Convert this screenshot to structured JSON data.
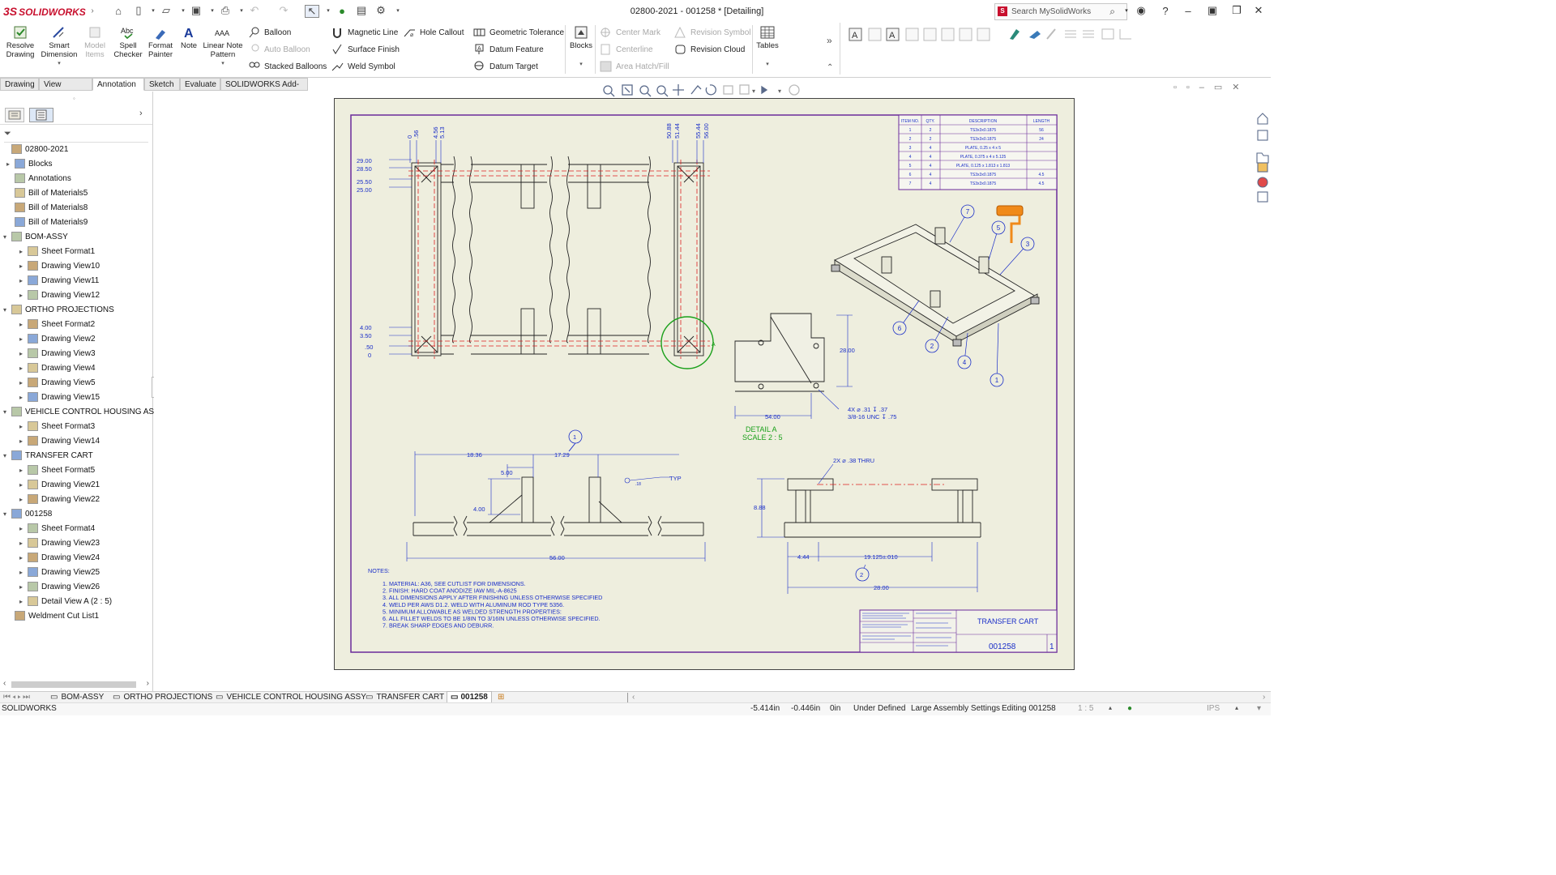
{
  "titlebar": {
    "logo_ds": "3S",
    "logo_text": "SOLIDWORKS",
    "document_title": "02800-2021 - 001258 * [Detailing]",
    "search_placeholder": "Search MySolidWorks"
  },
  "ribbon": {
    "big_buttons": [
      {
        "label1": "Resolve",
        "label2": "Drawing",
        "enabled": true
      },
      {
        "label1": "Smart",
        "label2": "Dimension",
        "enabled": true
      },
      {
        "label1": "Model",
        "label2": "Items",
        "enabled": false
      },
      {
        "label1": "Spell",
        "label2": "Checker",
        "enabled": true
      },
      {
        "label1": "Format",
        "label2": "Painter",
        "enabled": true
      },
      {
        "label1": "Note",
        "label2": "",
        "enabled": true
      },
      {
        "label1": "Linear Note",
        "label2": "Pattern",
        "enabled": true
      }
    ],
    "col1": [
      {
        "label": "Balloon",
        "enabled": true
      },
      {
        "label": "Auto Balloon",
        "enabled": false
      },
      {
        "label": "Stacked Balloons",
        "enabled": true
      }
    ],
    "col2": [
      {
        "label": "Magnetic Line",
        "enabled": true
      },
      {
        "label": "Surface Finish",
        "enabled": true
      },
      {
        "label": "Weld Symbol",
        "enabled": true
      }
    ],
    "hole_callout": "Hole Callout",
    "col3": [
      {
        "label": "Geometric Tolerance",
        "enabled": true
      },
      {
        "label": "Datum Feature",
        "enabled": true
      },
      {
        "label": "Datum Target",
        "enabled": true
      }
    ],
    "blocks": "Blocks",
    "col4": [
      {
        "label": "Center Mark",
        "enabled": false
      },
      {
        "label": "Centerline",
        "enabled": false
      },
      {
        "label": "Area Hatch/Fill",
        "enabled": false
      }
    ],
    "col5": [
      {
        "label": "Revision Symbol",
        "enabled": false
      },
      {
        "label": "Revision Cloud",
        "enabled": true
      }
    ],
    "tables": "Tables"
  },
  "tabs": [
    "Drawing",
    "View Layout",
    "Annotation",
    "Sketch",
    "Evaluate",
    "SOLIDWORKS Add-Ins"
  ],
  "active_tab": "Annotation",
  "tree": [
    {
      "label": "02800-2021",
      "level": 0,
      "arrow": ""
    },
    {
      "label": "Blocks",
      "level": 1,
      "arrow": "▸"
    },
    {
      "label": "Annotations",
      "level": 1,
      "arrow": ""
    },
    {
      "label": "Bill of Materials5",
      "level": 1,
      "arrow": ""
    },
    {
      "label": "Bill of Materials8",
      "level": 1,
      "arrow": ""
    },
    {
      "label": "Bill of Materials9",
      "level": 1,
      "arrow": ""
    },
    {
      "label": "BOM-ASSY",
      "level": 0,
      "arrow": "▾"
    },
    {
      "label": "Sheet Format1",
      "level": 2,
      "arrow": "▸"
    },
    {
      "label": "Drawing View10",
      "level": 2,
      "arrow": "▸"
    },
    {
      "label": "Drawing View11",
      "level": 2,
      "arrow": "▸"
    },
    {
      "label": "Drawing View12",
      "level": 2,
      "arrow": "▸"
    },
    {
      "label": "ORTHO PROJECTIONS",
      "level": 0,
      "arrow": "▾"
    },
    {
      "label": "Sheet Format2",
      "level": 2,
      "arrow": "▸"
    },
    {
      "label": "Drawing View2",
      "level": 2,
      "arrow": "▸"
    },
    {
      "label": "Drawing View3",
      "level": 2,
      "arrow": "▸"
    },
    {
      "label": "Drawing View4",
      "level": 2,
      "arrow": "▸"
    },
    {
      "label": "Drawing View5",
      "level": 2,
      "arrow": "▸"
    },
    {
      "label": "Drawing View15",
      "level": 2,
      "arrow": "▸"
    },
    {
      "label": "VEHICLE CONTROL HOUSING AS",
      "level": 0,
      "arrow": "▾"
    },
    {
      "label": "Sheet Format3",
      "level": 2,
      "arrow": "▸"
    },
    {
      "label": "Drawing View14",
      "level": 2,
      "arrow": "▸"
    },
    {
      "label": "TRANSFER CART",
      "level": 0,
      "arrow": "▾"
    },
    {
      "label": "Sheet Format5",
      "level": 2,
      "arrow": "▸"
    },
    {
      "label": "Drawing View21",
      "level": 2,
      "arrow": "▸"
    },
    {
      "label": "Drawing View22",
      "level": 2,
      "arrow": "▸"
    },
    {
      "label": "001258",
      "level": 0,
      "arrow": "▾"
    },
    {
      "label": "Sheet Format4",
      "level": 2,
      "arrow": "▸"
    },
    {
      "label": "Drawing View23",
      "level": 2,
      "arrow": "▸"
    },
    {
      "label": "Drawing View24",
      "level": 2,
      "arrow": "▸"
    },
    {
      "label": "Drawing View25",
      "level": 2,
      "arrow": "▸"
    },
    {
      "label": "Drawing View26",
      "level": 2,
      "arrow": "▸"
    },
    {
      "label": "Detail View A (2 : 5)",
      "level": 2,
      "arrow": "▸"
    },
    {
      "label": "Weldment Cut List1",
      "level": 1,
      "arrow": ""
    }
  ],
  "drawing": {
    "top_dims_left": [
      "0",
      ".56",
      "4.56",
      "5.13"
    ],
    "top_dims_right": [
      "50.88",
      "51.44",
      "55.44",
      "56.00"
    ],
    "left_dims_top": [
      "29.00",
      "28.50",
      "25.50",
      "25.00"
    ],
    "left_dims_bottom": [
      "4.00",
      "3.50",
      ".50",
      "0"
    ],
    "bom_headers": [
      "ITEM NO.",
      "QTY.",
      "DESCRIPTION",
      "LENGTH"
    ],
    "bom_rows": [
      [
        "1",
        "2",
        "TS3x3x0.1875",
        "56"
      ],
      [
        "2",
        "2",
        "TS3x3x0.1875",
        "24"
      ],
      [
        "3",
        "4",
        "PLATE, 0.25 x 4 x 5",
        ""
      ],
      [
        "4",
        "4",
        "PLATE, 0.375 x 4 x 5.125",
        ""
      ],
      [
        "5",
        "4",
        "PLATE, 0.125 x 1.813 x 1.813",
        ""
      ],
      [
        "6",
        "4",
        "TS3x3x0.1875",
        "4.5"
      ],
      [
        "7",
        "4",
        "TS3x3x0.1875",
        "4.5"
      ]
    ],
    "balloons_iso": [
      "7",
      "5",
      "3",
      "6",
      "2",
      "4",
      "1"
    ],
    "detail_dims": [
      "28.00",
      "54.00"
    ],
    "hole_callout_line1": "4X ⌀ .31 ↧ .37",
    "hole_callout_line2": "3/8-16 UNC ↧ .75",
    "detail_label": "DETAIL A",
    "detail_scale": "SCALE 2 : 5",
    "front_dims": [
      "18.36",
      "17.29",
      "5.00",
      "4.00",
      "56.00"
    ],
    "front_weld": "TYP",
    "front_weld_size": ".18",
    "front_balloon": "1",
    "side_hole": "2X ⌀ .38 THRU",
    "side_dims": [
      "8.88",
      "4.44",
      "19.125±.010",
      "28.00"
    ],
    "side_balloon": "2",
    "notes_title": "NOTES:",
    "notes": [
      "1.  MATERIAL:  A36, SEE CUTLIST FOR DIMENSIONS.",
      "2.  FINISH:  HARD COAT ANODIZE IAW MIL-A-8625",
      "3.  ALL DIMENSIONS APPLY AFTER FINISHING UNLESS OTHERWISE SPECIFIED",
      "4.  WELD PER AWS D1.2.  WELD WITH ALUMINUM ROD TYPE 5356.",
      "5.  MINIMUM ALLOWABLE AS WELDED STRENGTH PROPERTIES:",
      "6.  ALL FILLET WELDS TO BE 1/8IN TO 3/16IN UNLESS OTHERWISE SPECIFIED.",
      "7.  BREAK SHARP EDGES AND DEBURR."
    ],
    "title_block_title": "TRANSFER CART",
    "title_block_number": "001258",
    "title_block_sheet": "1"
  },
  "sheet_tabs": [
    "BOM-ASSY",
    "ORTHO PROJECTIONS",
    "VEHICLE CONTROL HOUSING ASSY",
    "TRANSFER CART",
    "001258"
  ],
  "active_sheet": "001258",
  "status": {
    "app": "SOLIDWORKS",
    "x": "-5.414in",
    "y": "-0.446in",
    "z": "0in",
    "state": "Under Defined",
    "settings": "Large Assembly Settings",
    "editing": "Editing 001258",
    "scale": "1 : 5",
    "units": "IPS"
  },
  "colors": {
    "sheet_bg": "#eeeede",
    "border": "#6a2a9a",
    "annotation": "#1a2ec8",
    "red": "#dd2020",
    "detail_green": "#1aa01a",
    "brand": "#c8102e"
  }
}
